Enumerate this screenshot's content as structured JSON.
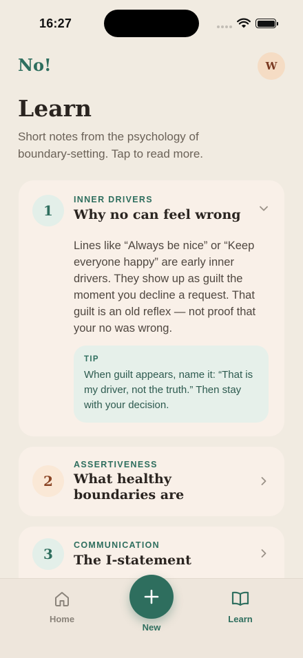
{
  "status": {
    "time": "16:27"
  },
  "header": {
    "logo": "No!",
    "avatar_initial": "W"
  },
  "page": {
    "title": "Learn",
    "subtitle": "Short notes from the psychology of boundary-setting. Tap to read more."
  },
  "cards": [
    {
      "number": "1",
      "kicker": "INNER DRIVERS",
      "title": "Why no can feel wrong",
      "expanded": true,
      "body": "Lines like “Always be nice” or “Keep everyone happy” are early inner drivers. They show up as guilt the moment you decline a request. That guilt is an old reflex — not proof that your no was wrong.",
      "tip_label": "TIP",
      "tip_text": "When guilt appears, name it: “That is my driver, not the truth.” Then stay with your decision."
    },
    {
      "number": "2",
      "kicker": "ASSERTIVENESS",
      "title": "What healthy boundaries are",
      "expanded": false
    },
    {
      "number": "3",
      "kicker": "COMMUNICATION",
      "title": "The I-statement",
      "expanded": false
    }
  ],
  "nav": {
    "home_label": "Home",
    "new_label": "New",
    "learn_label": "Learn",
    "active": "Learn"
  },
  "colors": {
    "background": "#f1ebe1",
    "accent": "#2e6e5e",
    "card": "#f9f0e8",
    "tip_background": "#e6f0ea"
  },
  "icons": [
    "wifi-icon",
    "battery-icon",
    "chevron-down-icon",
    "chevron-right-icon",
    "home-icon",
    "plus-icon",
    "book-icon"
  ]
}
